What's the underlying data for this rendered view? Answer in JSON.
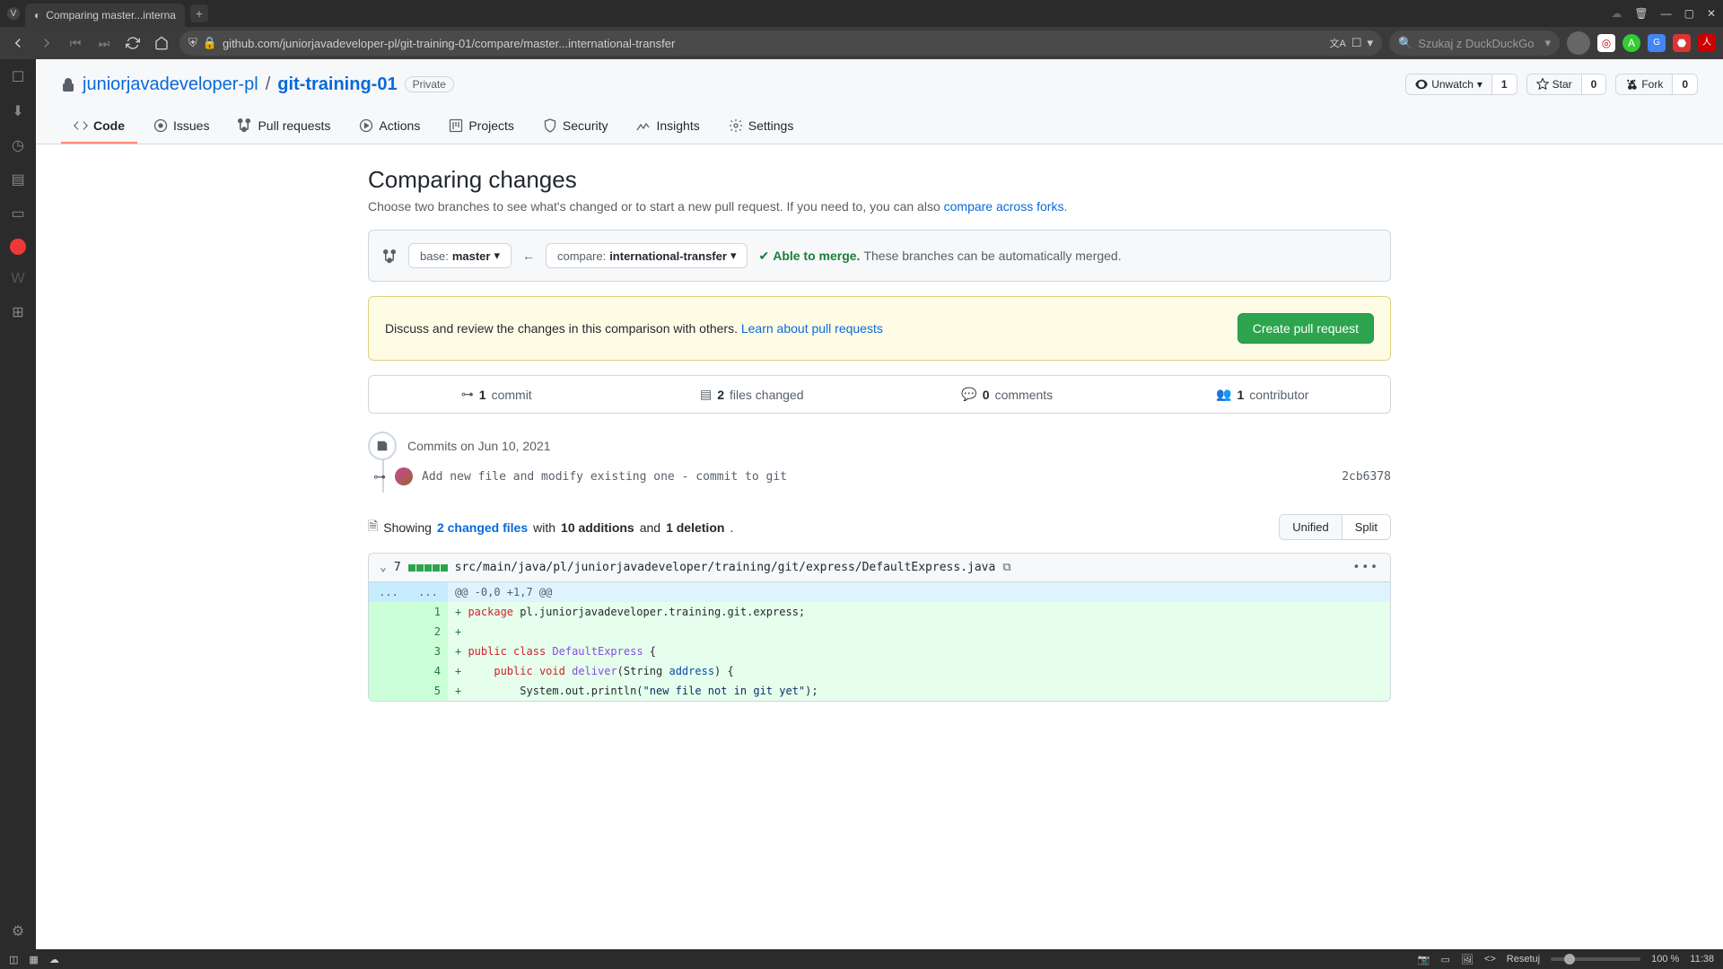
{
  "browser": {
    "tab_title": "Comparing master...interna",
    "url": "github.com/juniorjavadeveloper-pl/git-training-01/compare/master...international-transfer",
    "search_placeholder": "Szukaj z DuckDuckGo"
  },
  "bottombar": {
    "reset": "Resetuj",
    "zoom": "100 %",
    "time": "11:38"
  },
  "repo": {
    "owner": "juniorjavadeveloper-pl",
    "name": "git-training-01",
    "visibility": "Private",
    "unwatch_label": "Unwatch",
    "watch_count": "1",
    "star_label": "Star",
    "star_count": "0",
    "fork_label": "Fork",
    "fork_count": "0"
  },
  "tabs": {
    "code": "Code",
    "issues": "Issues",
    "pulls": "Pull requests",
    "actions": "Actions",
    "projects": "Projects",
    "security": "Security",
    "insights": "Insights",
    "settings": "Settings"
  },
  "compare": {
    "title": "Comparing changes",
    "subtitle_a": "Choose two branches to see what's changed or to start a new pull request. If you need to, you can also ",
    "subtitle_link": "compare across forks",
    "base_label": "base: ",
    "base_val": "master",
    "compare_label": "compare: ",
    "compare_val": "international-transfer",
    "able": "Able to merge.",
    "able_rest": " These branches can be automatically merged."
  },
  "banner": {
    "text": "Discuss and review the changes in this comparison with others. ",
    "link": "Learn about pull requests",
    "button": "Create pull request"
  },
  "stats": {
    "commits_n": "1",
    "commits_l": " commit",
    "files_n": "2",
    "files_l": " files changed",
    "comments_n": "0",
    "comments_l": " comments",
    "contrib_n": "1",
    "contrib_l": " contributor"
  },
  "timeline": {
    "date": "Commits on Jun 10, 2021",
    "commit_msg": "Add new file and modify existing one - commit to git",
    "commit_sha": "2cb6378"
  },
  "diffsummary": {
    "showing": "Showing ",
    "changed": "2 changed files",
    "with": " with ",
    "adds": "10 additions",
    "and": " and ",
    "dels": "1 deletion",
    "period": "."
  },
  "viewtoggle": {
    "unified": "Unified",
    "split": "Split"
  },
  "file": {
    "count": "7",
    "path": "src/main/java/pl/juniorjavadeveloper/training/git/express/DefaultExpress.java",
    "hunk": "@@ -0,0 +1,7 @@"
  },
  "code": {
    "l1_a": "package",
    "l1_b": " pl.juniorjavadeveloper.training.git.express;",
    "l3_a": "public",
    "l3_b": "class",
    "l3_c": "DefaultExpress",
    "l3_d": " {",
    "l4_a": "public",
    "l4_b": "void",
    "l4_c": "deliver",
    "l4_d": "(String ",
    "l4_e": "address",
    "l4_f": ") {",
    "l5_a": "        System.out.println(",
    "l5_b": "\"new file not in git yet\"",
    "l5_c": ");"
  }
}
